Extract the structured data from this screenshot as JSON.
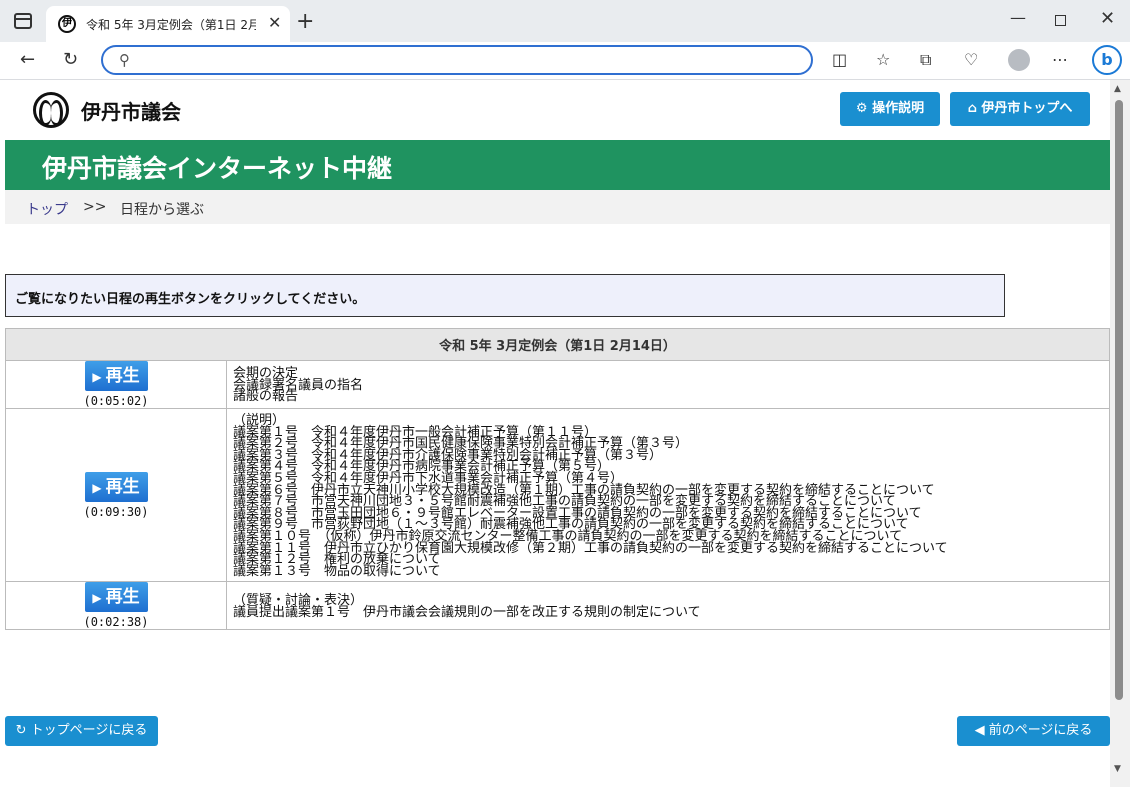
{
  "browser": {
    "tab_title": "令和 5年 3月定例会（第1日 2月1",
    "tab_favicon": "伊",
    "address_value": ""
  },
  "header": {
    "logo_text": "伊丹市議会",
    "help_button": "⚙ 操作説明",
    "top_button": "⌂ 伊丹市トップへ"
  },
  "banner": {
    "title": "伊丹市議会インターネット中継"
  },
  "breadcrumb": {
    "home": "トップ",
    "separator": ">>",
    "current": "日程から選ぶ"
  },
  "notice": "ご覧になりたい日程の再生ボタンをクリックしてください。",
  "schedule": {
    "heading": "令和 5年 3月定例会（第1日 2月14日）",
    "play_label": "再生",
    "rows": [
      {
        "duration": "(0:05:02)",
        "items": [
          "会期の決定",
          "会議録署名議員の指名",
          "諸般の報告"
        ]
      },
      {
        "duration": "(0:09:30)",
        "items": [
          "（説明）",
          "議案第１号　令和４年度伊丹市一般会計補正予算（第１１号）",
          "議案第２号　令和４年度伊丹市国民健康保険事業特別会計補正予算（第３号）",
          "議案第３号　令和４年度伊丹市介護保険事業特別会計補正予算（第３号）",
          "議案第４号　令和４年度伊丹市病院事業会計補正予算（第５号）",
          "議案第５号　令和４年度伊丹市下水道事業会計補正予算（第４号）",
          "議案第６号　伊丹市立天神川小学校大規模改造（第１期）工事の請負契約の一部を変更する契約を締結することについて",
          "議案第７号　市営天神川団地３・５号館耐震補強他工事の請負契約の一部を変更する契約を締結することについて",
          "議案第８号　市営玉田団地６・９号館エレベーター設置工事の請負契約の一部を変更する契約を締結することについて",
          "議案第９号　市営荻野団地（１～３号館）耐震補強他工事の請負契約の一部を変更する契約を締結することについて",
          "議案第１０号　（仮称）伊丹市鈴原交流センター整備工事の請負契約の一部を変更する契約を締結することについて",
          "議案第１１号　伊丹市立ひかり保育園大規模改修（第２期）工事の請負契約の一部を変更する契約を締結することについて",
          "議案第１２号　権利の放棄について",
          "議案第１３号　物品の取得について"
        ]
      },
      {
        "duration": "(0:02:38)",
        "items": [
          "（質疑・討論・表決）",
          "議員提出議案第１号　伊丹市議会会議規則の一部を改正する規則の制定について"
        ]
      }
    ]
  },
  "footer": {
    "top_page_button": "↻ トップページに戻る",
    "back_button": "◀ 前のページに戻る"
  },
  "colors": {
    "banner": "#1f9360",
    "button": "#1a8fd0",
    "play": "#1e6fd0"
  }
}
